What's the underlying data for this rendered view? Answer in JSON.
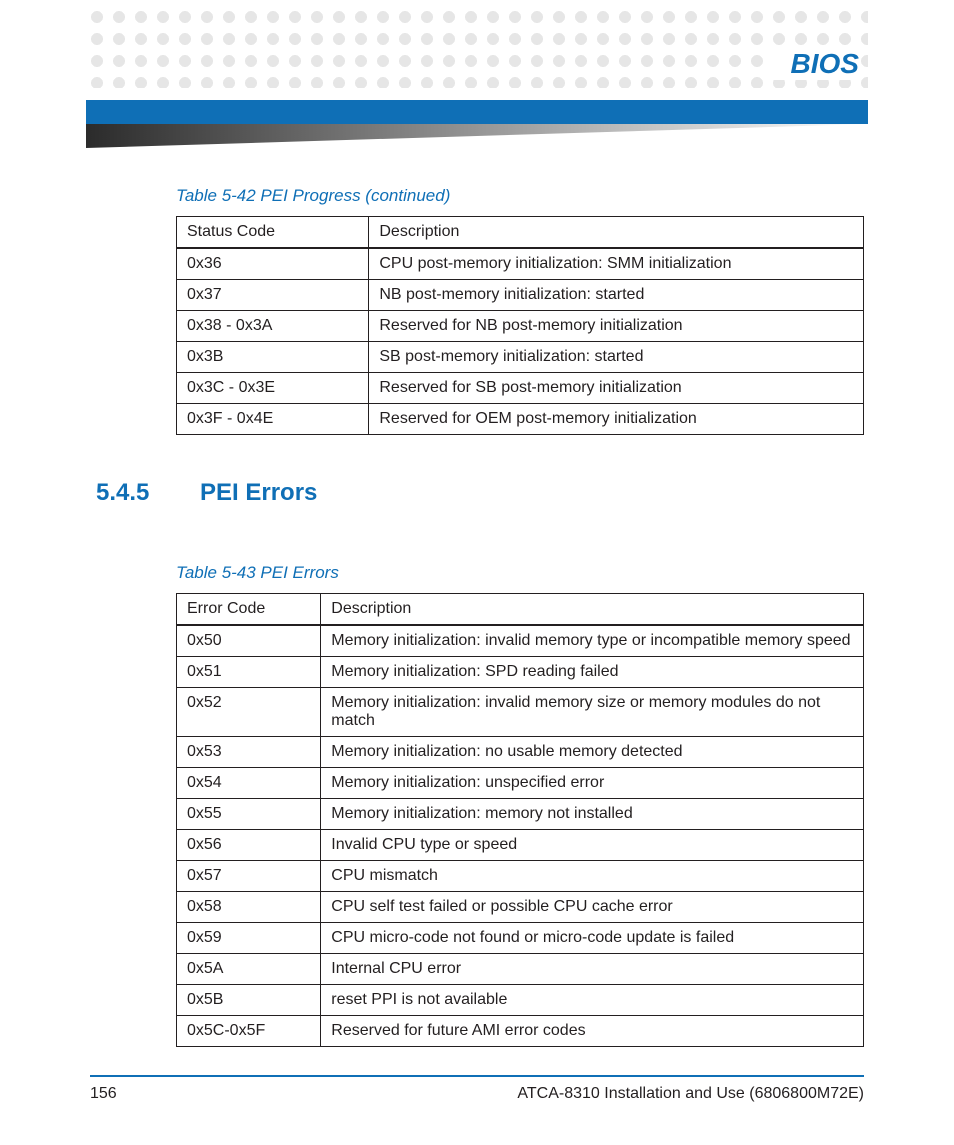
{
  "header": {
    "title": "BIOS"
  },
  "table1": {
    "caption": "Table 5-42 PEI Progress (continued)",
    "headers": [
      "Status Code",
      "Description"
    ],
    "rows": [
      [
        "0x36",
        "CPU post-memory initialization: SMM initialization"
      ],
      [
        "0x37",
        "NB post-memory initialization: started"
      ],
      [
        "0x38 - 0x3A",
        "Reserved for NB post-memory initialization"
      ],
      [
        "0x3B",
        "SB post-memory initialization: started"
      ],
      [
        "0x3C - 0x3E",
        "Reserved for SB post-memory initialization"
      ],
      [
        "0x3F - 0x4E",
        "Reserved for OEM post-memory initialization"
      ]
    ]
  },
  "section": {
    "number": "5.4.5",
    "title": "PEI Errors"
  },
  "table2": {
    "caption": "Table 5-43 PEI Errors",
    "headers": [
      "Error Code",
      "Description"
    ],
    "rows": [
      [
        "0x50",
        "Memory initialization: invalid memory type or incompatible memory speed"
      ],
      [
        "0x51",
        "Memory initialization: SPD reading failed"
      ],
      [
        "0x52",
        "Memory initialization: invalid memory size or memory modules do not match"
      ],
      [
        "0x53",
        "Memory initialization: no usable memory detected"
      ],
      [
        "0x54",
        "Memory initialization: unspecified error"
      ],
      [
        "0x55",
        "Memory initialization: memory not installed"
      ],
      [
        "0x56",
        "Invalid CPU type or speed"
      ],
      [
        "0x57",
        "CPU mismatch"
      ],
      [
        "0x58",
        "CPU self test failed or possible CPU cache error"
      ],
      [
        "0x59",
        "CPU micro-code not found or micro-code update is failed"
      ],
      [
        "0x5A",
        "Internal CPU error"
      ],
      [
        "0x5B",
        "reset PPI is not available"
      ],
      [
        "0x5C-0x5F",
        "Reserved for future AMI error codes"
      ]
    ]
  },
  "footer": {
    "page": "156",
    "doc": "ATCA-8310 Installation and Use (6806800M72E)"
  }
}
